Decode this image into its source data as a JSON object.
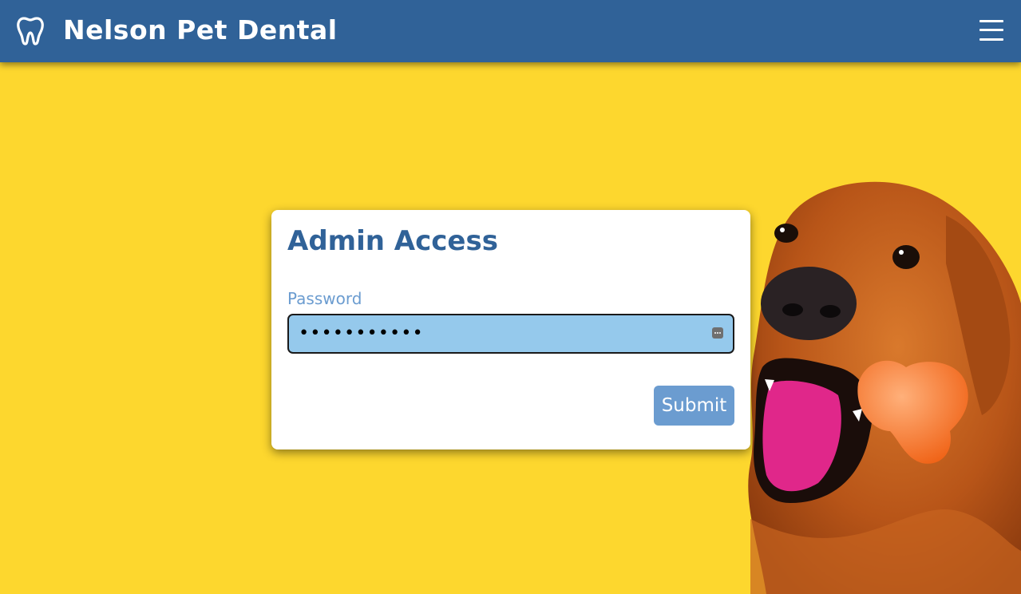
{
  "header": {
    "title": "Nelson Pet Dental",
    "logo_icon": "tooth-icon",
    "menu_icon": "hamburger-menu-icon"
  },
  "login": {
    "title": "Admin Access",
    "password_label": "Password",
    "password_value": "•••••••••••",
    "submit_label": "Submit"
  },
  "colors": {
    "header_bg": "#306298",
    "page_bg": "#fdd72e",
    "input_bg": "#95c9ec",
    "button_bg": "#6b9cd0"
  }
}
